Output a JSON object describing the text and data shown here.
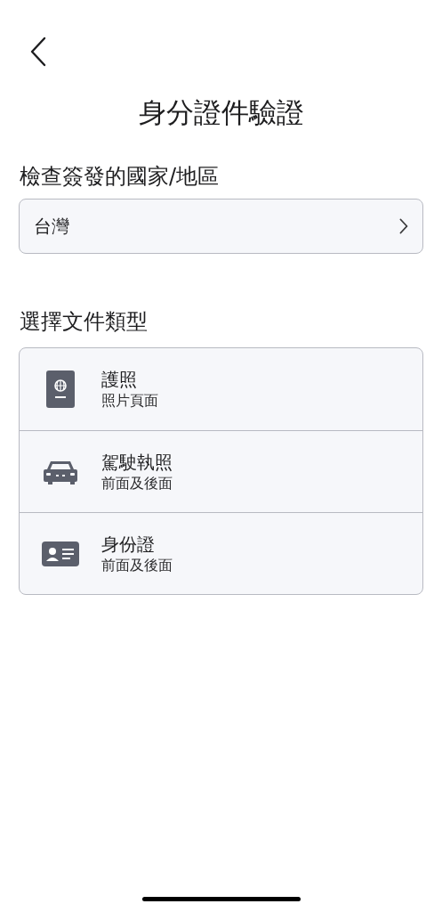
{
  "title": "身分證件驗證",
  "country_section": {
    "label": "檢查簽發的國家/地區",
    "value": "台灣"
  },
  "document_section": {
    "label": "選擇文件類型",
    "options": [
      {
        "kind": "passport",
        "title": "護照",
        "subtitle": "照片頁面"
      },
      {
        "kind": "car",
        "title": "駕駛執照",
        "subtitle": "前面及後面"
      },
      {
        "kind": "id-card",
        "title": "身份證",
        "subtitle": "前面及後面"
      }
    ]
  }
}
